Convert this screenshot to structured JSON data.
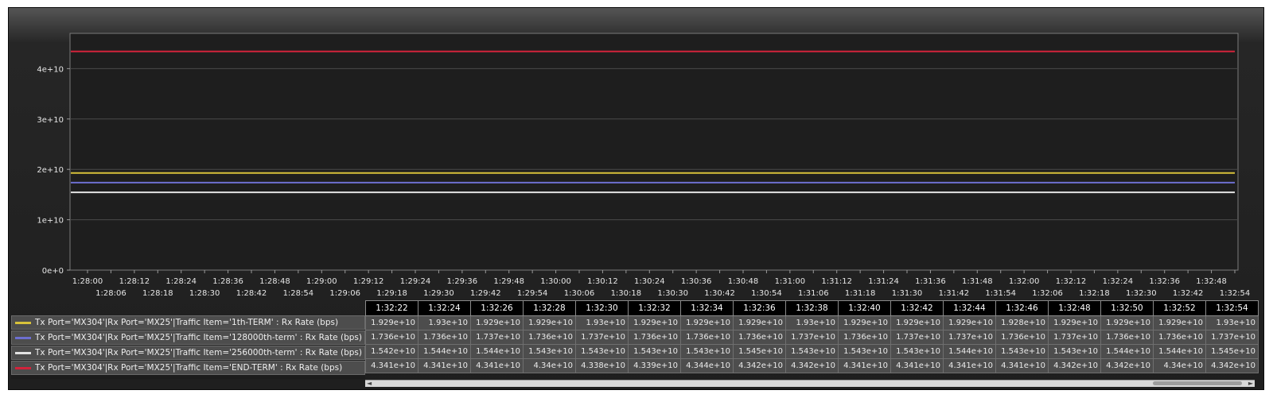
{
  "chart_data": {
    "type": "line",
    "y_ticks": [
      "0e+0",
      "1e+10",
      "2e+10",
      "3e+10",
      "4e+10"
    ],
    "ylim": [
      0,
      47000000000.0
    ],
    "x_ticks_row1": [
      "1:28:00",
      "1:28:12",
      "1:28:24",
      "1:28:36",
      "1:28:48",
      "1:29:00",
      "1:29:12",
      "1:29:24",
      "1:29:36",
      "1:29:48",
      "1:30:00",
      "1:30:12",
      "1:30:24",
      "1:30:36",
      "1:30:48",
      "1:31:00",
      "1:31:12",
      "1:31:24",
      "1:31:36",
      "1:31:48",
      "1:32:00",
      "1:32:12",
      "1:32:24",
      "1:32:36",
      "1:32:48"
    ],
    "x_ticks_row2": [
      "1:28:06",
      "1:28:18",
      "1:28:30",
      "1:28:42",
      "1:28:54",
      "1:29:06",
      "1:29:18",
      "1:29:30",
      "1:29:42",
      "1:29:54",
      "1:30:06",
      "1:30:18",
      "1:30:30",
      "1:30:42",
      "1:30:54",
      "1:31:06",
      "1:31:18",
      "1:31:30",
      "1:31:42",
      "1:31:54",
      "1:32:06",
      "1:32:18",
      "1:32:30",
      "1:32:42",
      "1:32:54"
    ],
    "x_range": [
      "1:28:00",
      "1:32:54"
    ],
    "grid": true,
    "series": [
      {
        "name": "Tx Port='MX304'|Rx Port='MX25'|Traffic Item='1th-TERM' : Rx Rate (bps)",
        "color": "#d8c23a",
        "value": 19290000000.0
      },
      {
        "name": "Tx Port='MX304'|Rx Port='MX25'|Traffic Item='128000th-term' : Rx Rate (bps)",
        "color": "#6d6fd0",
        "value": 17360000000.0
      },
      {
        "name": "Tx Port='MX304'|Rx Port='MX25'|Traffic Item='256000th-term' : Rx Rate (bps)",
        "color": "#e2e2e2",
        "value": 15430000000.0
      },
      {
        "name": "Tx Port='MX304'|Rx Port='MX25'|Traffic Item='END-TERM' : Rx Rate (bps)",
        "color": "#d2233b",
        "value": 43410000000.0
      }
    ]
  },
  "table": {
    "times": [
      "1:32:22",
      "1:32:24",
      "1:32:26",
      "1:32:28",
      "1:32:30",
      "1:32:32",
      "1:32:34",
      "1:32:36",
      "1:32:38",
      "1:32:40",
      "1:32:42",
      "1:32:44",
      "1:32:46",
      "1:32:48",
      "1:32:50",
      "1:32:52",
      "1:32:54"
    ],
    "rows": [
      [
        "1.929e+10",
        "1.93e+10",
        "1.929e+10",
        "1.929e+10",
        "1.93e+10",
        "1.929e+10",
        "1.929e+10",
        "1.929e+10",
        "1.93e+10",
        "1.929e+10",
        "1.929e+10",
        "1.929e+10",
        "1.928e+10",
        "1.929e+10",
        "1.929e+10",
        "1.929e+10",
        "1.93e+10"
      ],
      [
        "1.736e+10",
        "1.736e+10",
        "1.737e+10",
        "1.736e+10",
        "1.737e+10",
        "1.736e+10",
        "1.736e+10",
        "1.736e+10",
        "1.737e+10",
        "1.736e+10",
        "1.737e+10",
        "1.737e+10",
        "1.736e+10",
        "1.737e+10",
        "1.736e+10",
        "1.736e+10",
        "1.737e+10"
      ],
      [
        "1.542e+10",
        "1.544e+10",
        "1.544e+10",
        "1.543e+10",
        "1.543e+10",
        "1.543e+10",
        "1.543e+10",
        "1.545e+10",
        "1.543e+10",
        "1.543e+10",
        "1.543e+10",
        "1.544e+10",
        "1.543e+10",
        "1.543e+10",
        "1.544e+10",
        "1.544e+10",
        "1.545e+10"
      ],
      [
        "4.341e+10",
        "4.341e+10",
        "4.341e+10",
        "4.34e+10",
        "4.338e+10",
        "4.339e+10",
        "4.344e+10",
        "4.342e+10",
        "4.342e+10",
        "4.341e+10",
        "4.341e+10",
        "4.341e+10",
        "4.341e+10",
        "4.342e+10",
        "4.342e+10",
        "4.34e+10",
        "4.342e+10"
      ]
    ]
  },
  "scrollbar": {
    "left_arrow": "◄",
    "right_arrow": "►"
  }
}
